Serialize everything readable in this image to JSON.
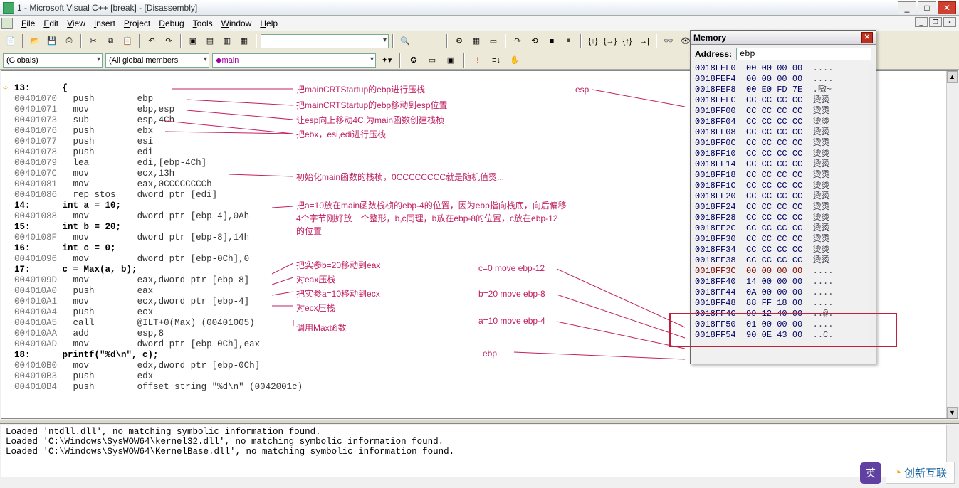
{
  "window": {
    "title": "1 - Microsoft Visual C++ [break] - [Disassembly]"
  },
  "menu": {
    "file": "File",
    "edit": "Edit",
    "view": "View",
    "insert": "Insert",
    "project": "Project",
    "debug": "Debug",
    "tools": "Tools",
    "window": "Window",
    "help": "Help"
  },
  "combos": {
    "globals": "(Globals)",
    "members": "(All global members",
    "main": "main"
  },
  "disasm": {
    "l13": "13:      {",
    "r1": {
      "a": "00401070",
      "op": "push",
      "arg": "ebp"
    },
    "r2": {
      "a": "00401071",
      "op": "mov",
      "arg": "ebp,esp"
    },
    "r3": {
      "a": "00401073",
      "op": "sub",
      "arg": "esp,4Ch"
    },
    "r4": {
      "a": "00401076",
      "op": "push",
      "arg": "ebx"
    },
    "r5": {
      "a": "00401077",
      "op": "push",
      "arg": "esi"
    },
    "r6": {
      "a": "00401078",
      "op": "push",
      "arg": "edi"
    },
    "r7": {
      "a": "00401079",
      "op": "lea",
      "arg": "edi,[ebp-4Ch]"
    },
    "r8": {
      "a": "0040107C",
      "op": "mov",
      "arg": "ecx,13h"
    },
    "r9": {
      "a": "00401081",
      "op": "mov",
      "arg": "eax,0CCCCCCCCh"
    },
    "r10": {
      "a": "00401086",
      "op": "rep stos",
      "arg": "dword ptr [edi]"
    },
    "l14": "14:      int a = 10;",
    "r11": {
      "a": "00401088",
      "op": "mov",
      "arg": "dword ptr [ebp-4],0Ah"
    },
    "l15": "15:      int b = 20;",
    "r12": {
      "a": "0040108F",
      "op": "mov",
      "arg": "dword ptr [ebp-8],14h"
    },
    "l16": "16:      int c = 0;",
    "r13": {
      "a": "00401096",
      "op": "mov",
      "arg": "dword ptr [ebp-0Ch],0"
    },
    "l17": "17:      c = Max(a, b);",
    "r14": {
      "a": "0040109D",
      "op": "mov",
      "arg": "eax,dword ptr [ebp-8]"
    },
    "r15": {
      "a": "004010A0",
      "op": "push",
      "arg": "eax"
    },
    "r16": {
      "a": "004010A1",
      "op": "mov",
      "arg": "ecx,dword ptr [ebp-4]"
    },
    "r17": {
      "a": "004010A4",
      "op": "push",
      "arg": "ecx"
    },
    "r18": {
      "a": "004010A5",
      "op": "call",
      "arg": "@ILT+0(Max) (00401005)"
    },
    "r19": {
      "a": "004010AA",
      "op": "add",
      "arg": "esp,8"
    },
    "r20": {
      "a": "004010AD",
      "op": "mov",
      "arg": "dword ptr [ebp-0Ch],eax"
    },
    "l18": "18:      printf(\"%d\\n\", c);",
    "r21": {
      "a": "004010B0",
      "op": "mov",
      "arg": "edx,dword ptr [ebp-0Ch]"
    },
    "r22": {
      "a": "004010B3",
      "op": "push",
      "arg": "edx"
    },
    "r23": {
      "a": "004010B4",
      "op": "push",
      "arg": "offset string \"%d\\n\" (0042001c)"
    }
  },
  "ann": {
    "a1": "把mainCRTStartup的ebp进行压栈",
    "a2": "把mainCRTStartup的ebp移动到esp位置",
    "a3": "让esp向上移动4C,为main函数创建栈桢",
    "a4": "把ebx，esi,edi进行压栈",
    "a5": "初始化main函数的栈桢，0CCCCCCCC就是随机值烫...",
    "a6": "把a=10放在main函数栈桢的ebp-4的位置，因为ebp指向栈底，向后偏移",
    "a6b": "4个字节刚好放一个整形，b,c同理，b放在ebp-8的位置，c放在ebp-12",
    "a6c": "的位置",
    "a7": "把实参b=20移动到eax",
    "a8": "对eax压栈",
    "a9": "把实参a=10移动到ecx",
    "a10": "对ecx压栈",
    "a11": "调用Max函数",
    "esp": "esp",
    "ebp": "ebp",
    "c0": "c=0 move  ebp-12",
    "b20": "b=20 move ebp-8",
    "a10v": "a=10 move ebp-4"
  },
  "memory": {
    "title": "Memory",
    "addrlabel": "Address:",
    "addrval": "ebp",
    "rows": [
      {
        "a": "0018FEF0",
        "b": "00 00 00 00",
        "s": "...."
      },
      {
        "a": "0018FEF4",
        "b": "00 00 00 00",
        "s": "...."
      },
      {
        "a": "0018FEF8",
        "b": "00 E0 FD 7E",
        "s": ".嗷~"
      },
      {
        "a": "0018FEFC",
        "b": "CC CC CC CC",
        "s": "烫烫"
      },
      {
        "a": "0018FF00",
        "b": "CC CC CC CC",
        "s": "烫烫"
      },
      {
        "a": "0018FF04",
        "b": "CC CC CC CC",
        "s": "烫烫"
      },
      {
        "a": "0018FF08",
        "b": "CC CC CC CC",
        "s": "烫烫"
      },
      {
        "a": "0018FF0C",
        "b": "CC CC CC CC",
        "s": "烫烫"
      },
      {
        "a": "0018FF10",
        "b": "CC CC CC CC",
        "s": "烫烫"
      },
      {
        "a": "0018FF14",
        "b": "CC CC CC CC",
        "s": "烫烫"
      },
      {
        "a": "0018FF18",
        "b": "CC CC CC CC",
        "s": "烫烫"
      },
      {
        "a": "0018FF1C",
        "b": "CC CC CC CC",
        "s": "烫烫"
      },
      {
        "a": "0018FF20",
        "b": "CC CC CC CC",
        "s": "烫烫"
      },
      {
        "a": "0018FF24",
        "b": "CC CC CC CC",
        "s": "烫烫"
      },
      {
        "a": "0018FF28",
        "b": "CC CC CC CC",
        "s": "烫烫"
      },
      {
        "a": "0018FF2C",
        "b": "CC CC CC CC",
        "s": "烫烫"
      },
      {
        "a": "0018FF30",
        "b": "CC CC CC CC",
        "s": "烫烫"
      },
      {
        "a": "0018FF34",
        "b": "CC CC CC CC",
        "s": "烫烫"
      },
      {
        "a": "0018FF38",
        "b": "CC CC CC CC",
        "s": "烫烫"
      },
      {
        "a": "0018FF3C",
        "b": "00 00 00 00",
        "s": "....",
        "hl": true
      },
      {
        "a": "0018FF40",
        "b": "14 00 00 00",
        "s": "...."
      },
      {
        "a": "0018FF44",
        "b": "0A 00 00 00",
        "s": "...."
      },
      {
        "a": "0018FF48",
        "b": "88 FF 18 00",
        "s": "...."
      },
      {
        "a": "0018FF4C",
        "b": "99 12 40 00",
        "s": "..@."
      },
      {
        "a": "0018FF50",
        "b": "01 00 00 00",
        "s": "...."
      },
      {
        "a": "0018FF54",
        "b": "90 0E 43 00",
        "s": "..C."
      }
    ]
  },
  "output": {
    "l1": "Loaded 'ntdll.dll', no matching symbolic information found.",
    "l2": "Loaded 'C:\\Windows\\SysWOW64\\kernel32.dll', no matching symbolic information found.",
    "l3": "Loaded 'C:\\Windows\\SysWOW64\\KernelBase.dll', no matching symbolic information found."
  },
  "watermark": "创新互联"
}
